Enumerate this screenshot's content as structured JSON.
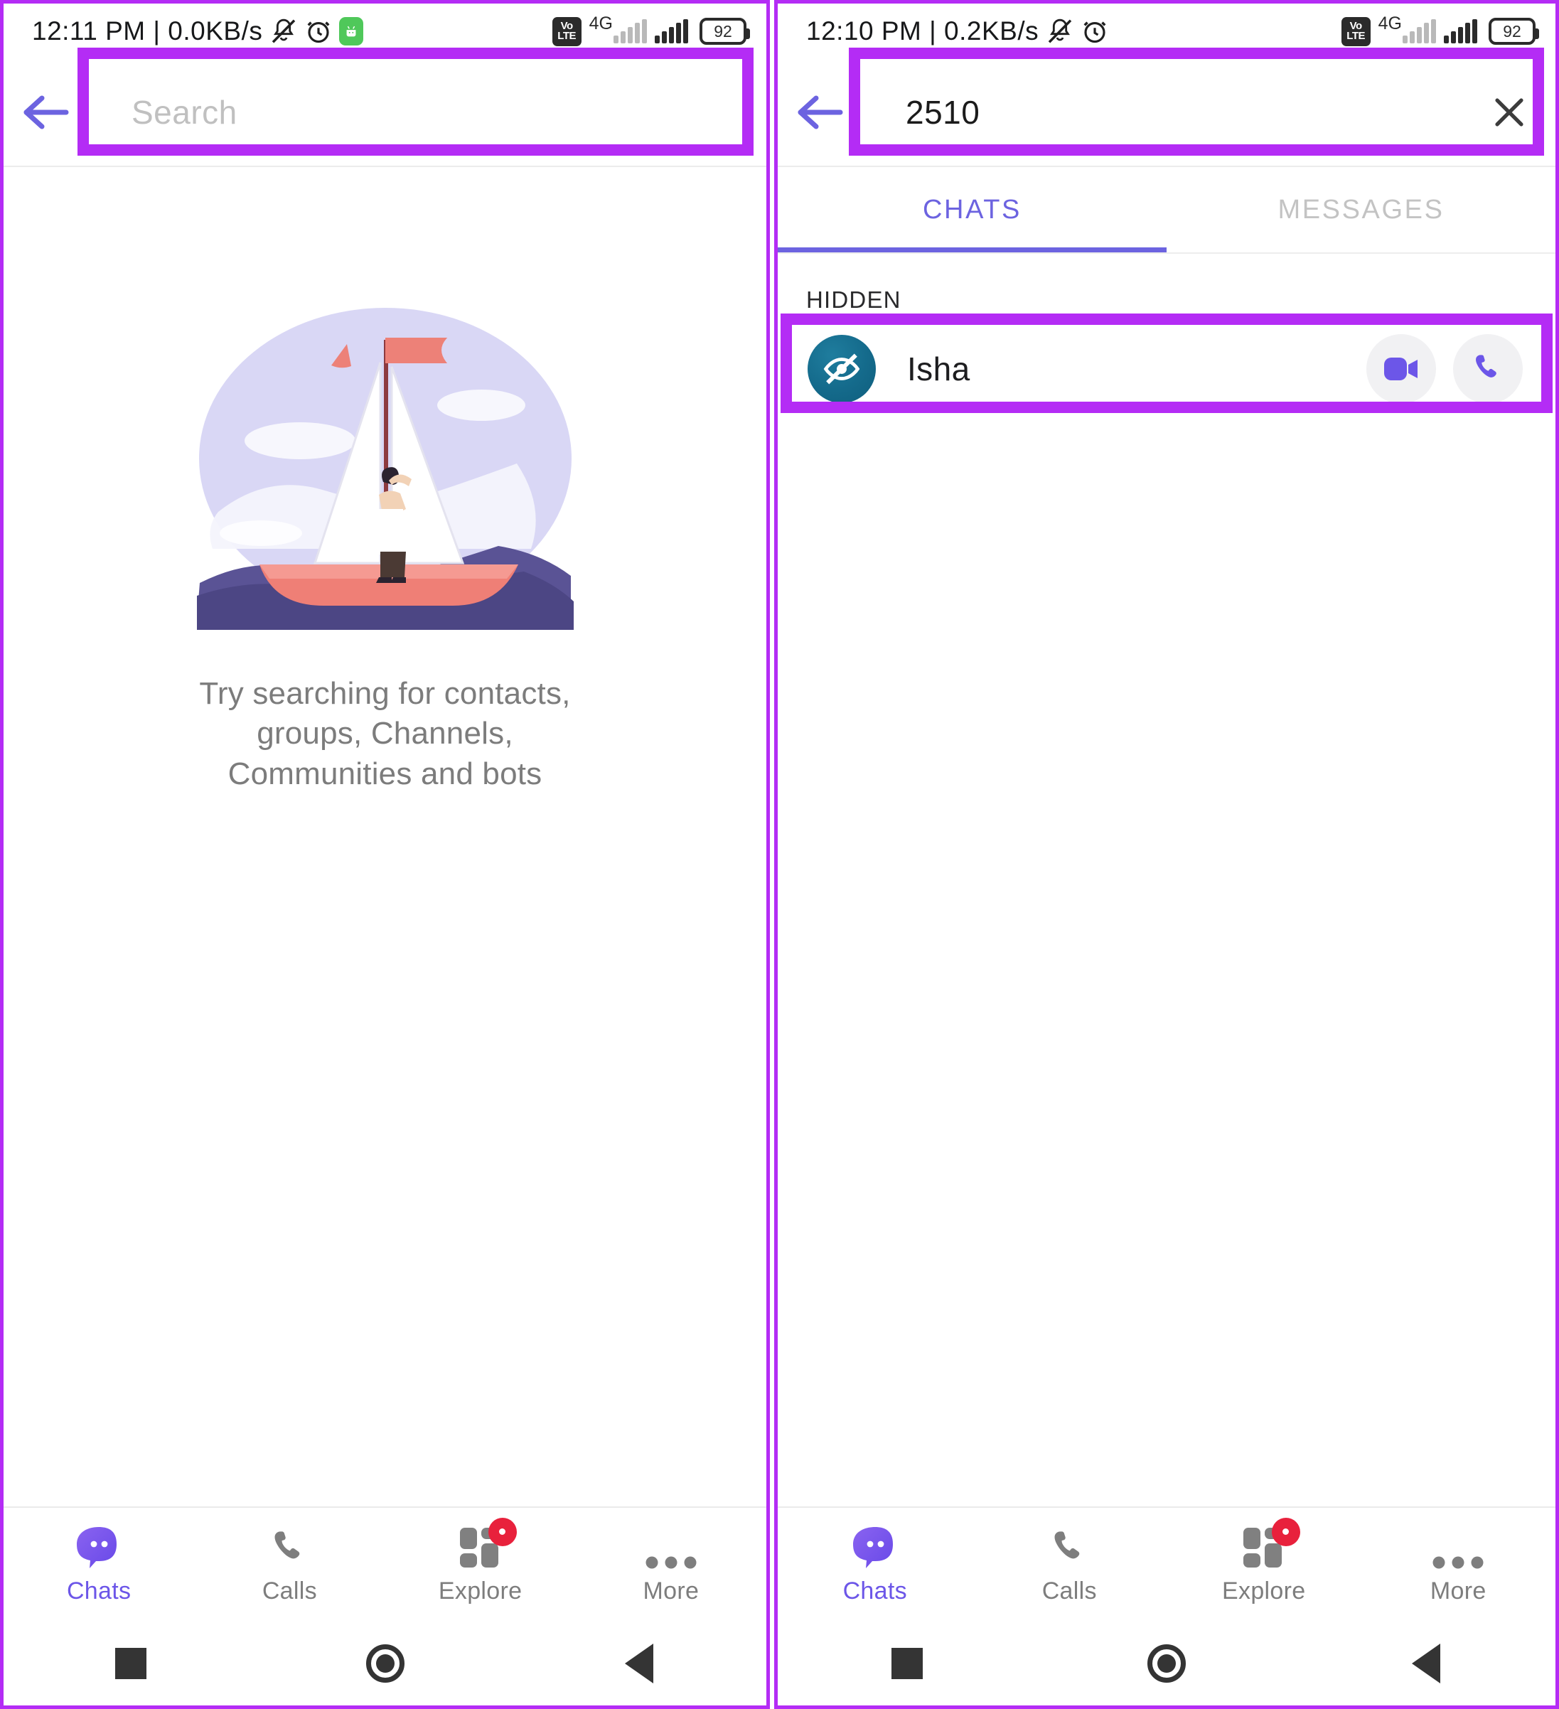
{
  "accent": {
    "annotation_purple": "#b42cf5",
    "brand_indigo": "#6c56e8",
    "badge_red": "#e8213c",
    "avatar_teal": "#146a8b"
  },
  "left_panel": {
    "statusbar": {
      "clock": "12:11 PM | 0.0KB/s",
      "mute_icon": "bell-muted-icon",
      "alarm_icon": "alarm-clock-icon",
      "app_icon": "green-app-icon",
      "volte_line1": "Vo",
      "volte_line2": "LTE",
      "network_label": "4G",
      "battery_level": "92"
    },
    "search": {
      "back_icon": "back-arrow-icon",
      "placeholder": "Search",
      "value": ""
    },
    "empty_state": {
      "illustration": "sailboat-illustration",
      "message_lines": [
        "Try searching for contacts,",
        "groups, Channels,",
        "Communities and bots"
      ]
    },
    "bottom_nav": [
      {
        "label": "Chats",
        "icon": "chat-bubble-icon",
        "active": true,
        "badge": false
      },
      {
        "label": "Calls",
        "icon": "phone-icon",
        "active": false,
        "badge": false
      },
      {
        "label": "Explore",
        "icon": "grid-explore-icon",
        "active": false,
        "badge": true
      },
      {
        "label": "More",
        "icon": "more-dots-icon",
        "active": false,
        "badge": false
      }
    ],
    "system_nav": [
      "recents-square-icon",
      "home-circle-icon",
      "back-triangle-icon"
    ]
  },
  "right_panel": {
    "statusbar": {
      "clock": "12:10 PM | 0.2KB/s",
      "mute_icon": "bell-muted-icon",
      "alarm_icon": "alarm-clock-icon",
      "volte_line1": "Vo",
      "volte_line2": "LTE",
      "network_label": "4G",
      "battery_level": "92"
    },
    "search": {
      "back_icon": "back-arrow-icon",
      "placeholder": "Search",
      "value": "2510",
      "clear_icon": "close-x-icon"
    },
    "tabs": [
      {
        "label": "CHATS",
        "active": true
      },
      {
        "label": "MESSAGES",
        "active": false
      }
    ],
    "results": {
      "section_label": "HIDDEN",
      "items": [
        {
          "name": "Isha",
          "avatar_icon": "eye-hidden-icon",
          "video_call_icon": "video-camera-icon",
          "voice_call_icon": "phone-icon"
        }
      ]
    },
    "bottom_nav": [
      {
        "label": "Chats",
        "icon": "chat-bubble-icon",
        "active": true,
        "badge": false
      },
      {
        "label": "Calls",
        "icon": "phone-icon",
        "active": false,
        "badge": false
      },
      {
        "label": "Explore",
        "icon": "grid-explore-icon",
        "active": false,
        "badge": true
      },
      {
        "label": "More",
        "icon": "more-dots-icon",
        "active": false,
        "badge": false
      }
    ],
    "system_nav": [
      "recents-square-icon",
      "home-circle-icon",
      "back-triangle-icon"
    ]
  }
}
